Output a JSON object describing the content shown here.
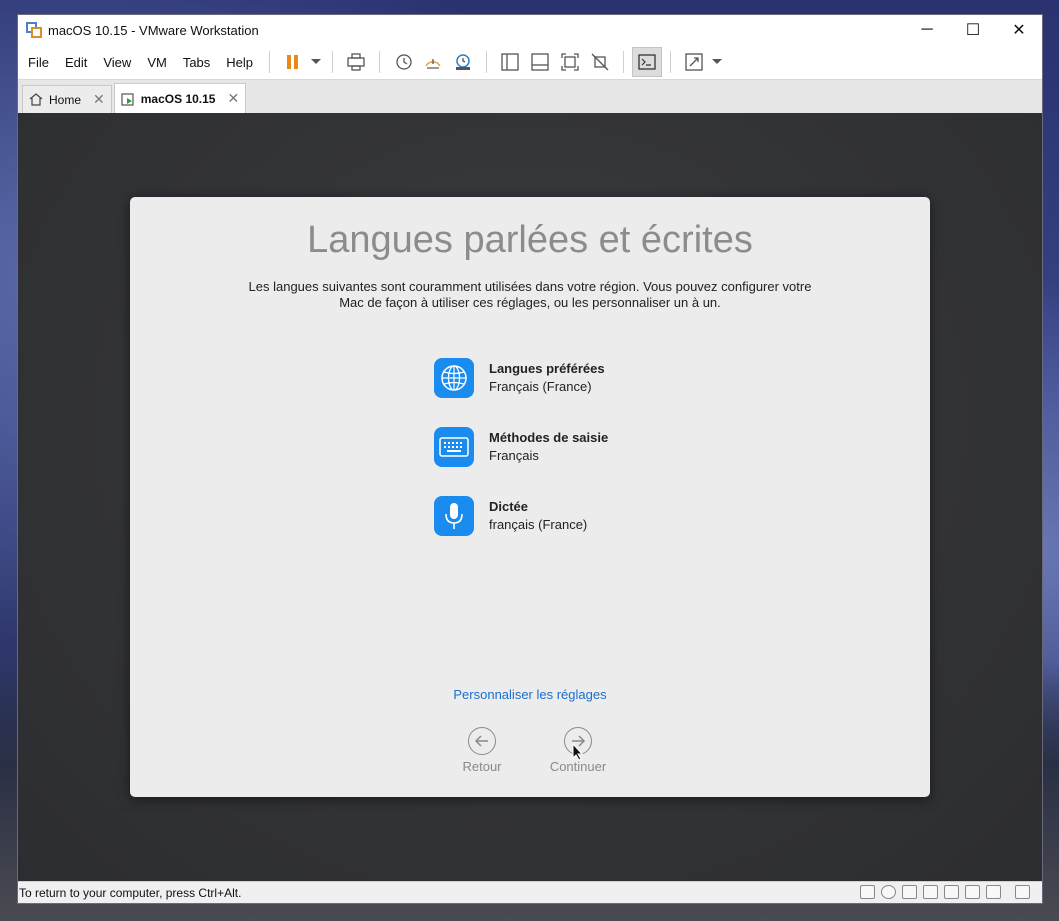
{
  "window": {
    "title": "macOS 10.15 - VMware Workstation",
    "minimize": "─",
    "maximize": "☐",
    "close": "✕"
  },
  "menu": {
    "items": [
      "File",
      "Edit",
      "View",
      "VM",
      "Tabs",
      "Help"
    ]
  },
  "tabs": [
    {
      "label": "Home",
      "close": "✕"
    },
    {
      "label": "macOS 10.15",
      "close": "✕"
    }
  ],
  "setup": {
    "title": "Langues parlées et écrites",
    "description_line1": "Les langues suivantes sont couramment utilisées dans votre région. Vous pouvez configurer votre",
    "description_line2": "Mac de façon à utiliser ces réglages, ou les personnaliser un à un.",
    "options": [
      {
        "title": "Langues préférées",
        "value": "Français (France)",
        "icon": "globe-icon"
      },
      {
        "title": "Méthodes de saisie",
        "value": "Français",
        "icon": "keyboard-icon"
      },
      {
        "title": "Dictée",
        "value": "français (France)",
        "icon": "microphone-icon"
      }
    ],
    "customize_link": "Personnaliser les réglages",
    "back_label": "Retour",
    "continue_label": "Continuer"
  },
  "statusbar": {
    "text": "To return to your computer, press Ctrl+Alt."
  },
  "colors": {
    "accent": "#1a8cf0",
    "link": "#1a6fd0",
    "pause": "#e8891e"
  }
}
